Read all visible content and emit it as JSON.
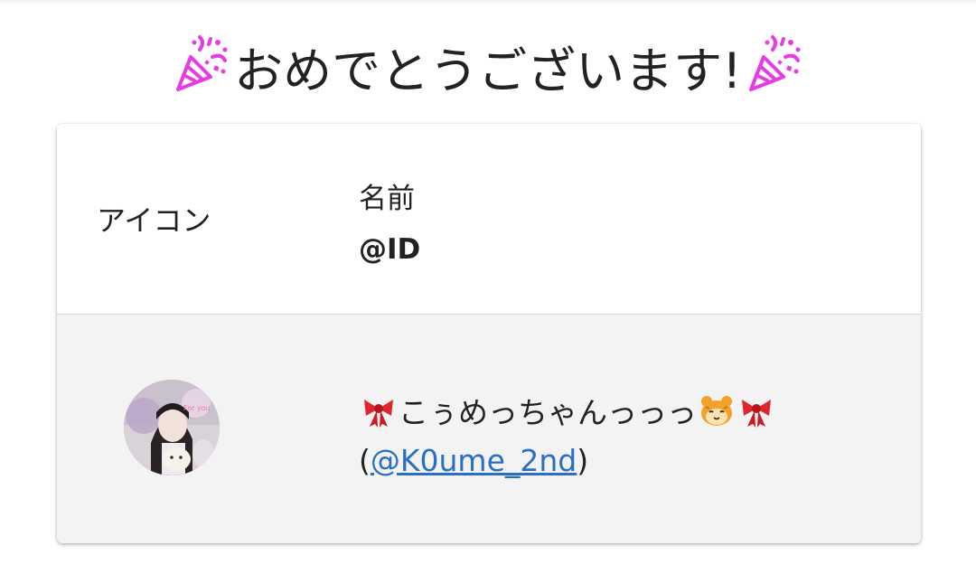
{
  "title": {
    "text": "おめでとうございます!",
    "icon_left": "party-popper-icon",
    "icon_right": "party-popper-icon",
    "icon_color": "#e83ce3"
  },
  "table": {
    "header": {
      "icon_label": "アイコン",
      "name_label": "名前",
      "id_label": "@ID"
    },
    "rows": [
      {
        "avatar": "user-avatar",
        "name": "こぅめっちゃんっっっ",
        "name_emojis": [
          "ribbon-icon",
          "hamster-icon",
          "ribbon-icon"
        ],
        "id_open": "(",
        "id_handle": "@K0ume_2nd",
        "id_close": ")"
      }
    ]
  },
  "colors": {
    "link": "#2a6fc4",
    "row_background": "#f3f3f3",
    "ribbon": "#e0252f",
    "hamster": "#f2a12a"
  }
}
